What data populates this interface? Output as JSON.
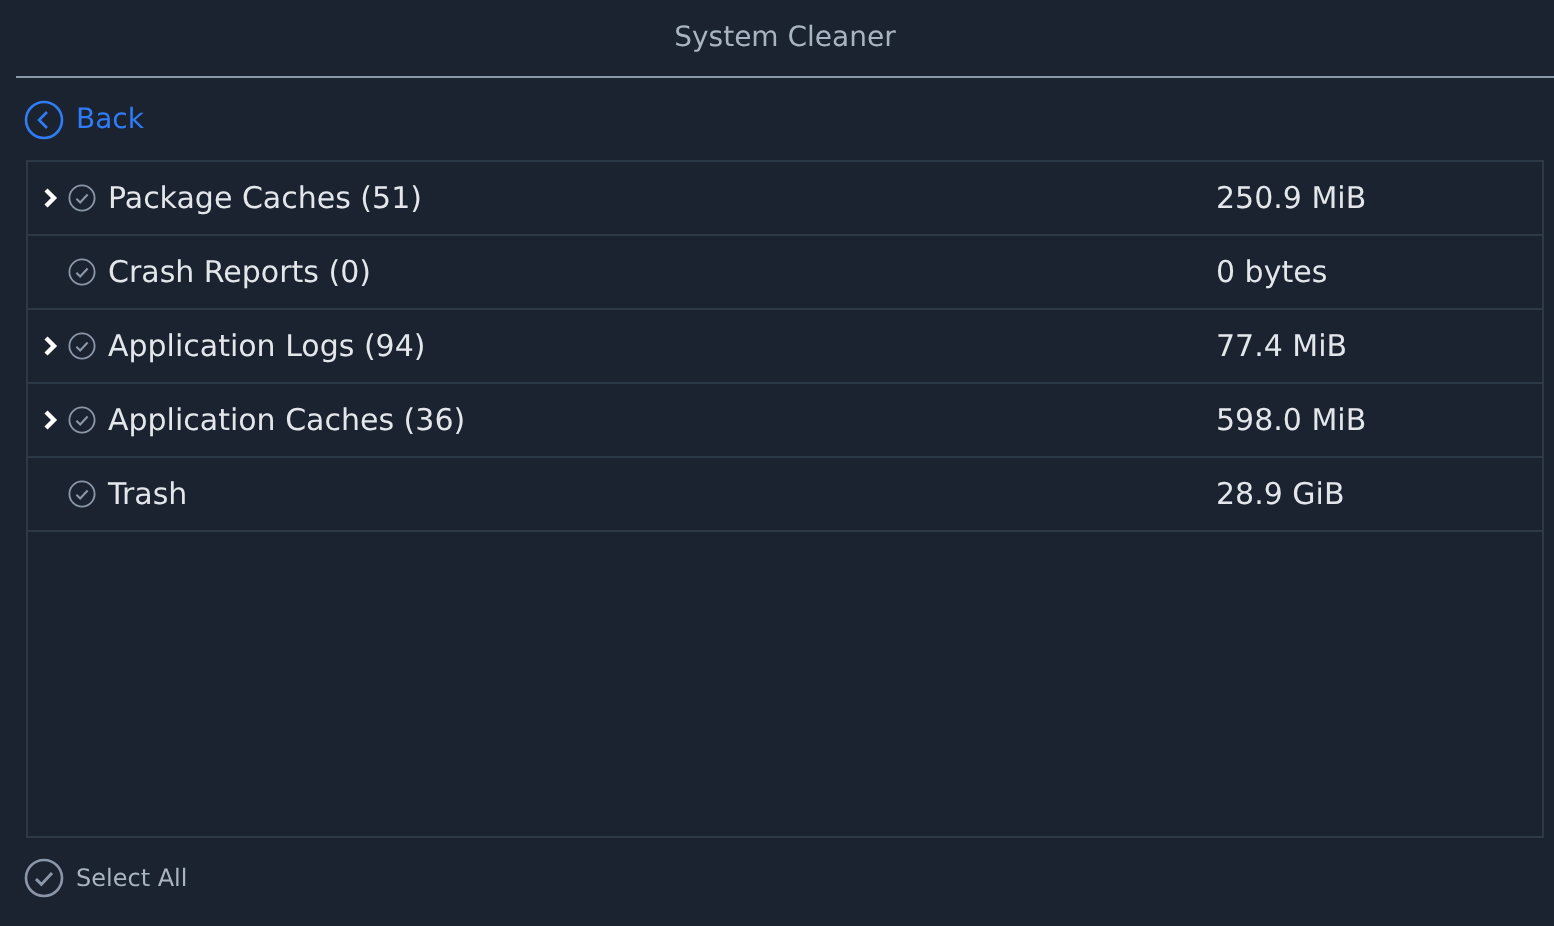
{
  "window": {
    "title": "System Cleaner"
  },
  "back": {
    "label": "Back"
  },
  "items": [
    {
      "name": "Package Caches (51)",
      "size": "250.9 MiB",
      "expandable": true,
      "checked": false
    },
    {
      "name": "Crash Reports (0)",
      "size": "0 bytes",
      "expandable": false,
      "checked": false
    },
    {
      "name": "Application Logs (94)",
      "size": "77.4 MiB",
      "expandable": true,
      "checked": false
    },
    {
      "name": "Application Caches (36)",
      "size": "598.0 MiB",
      "expandable": true,
      "checked": false
    },
    {
      "name": "Trash",
      "size": "28.9 GiB",
      "expandable": false,
      "checked": false
    }
  ],
  "select_all": {
    "label": "Select All",
    "checked": false
  }
}
